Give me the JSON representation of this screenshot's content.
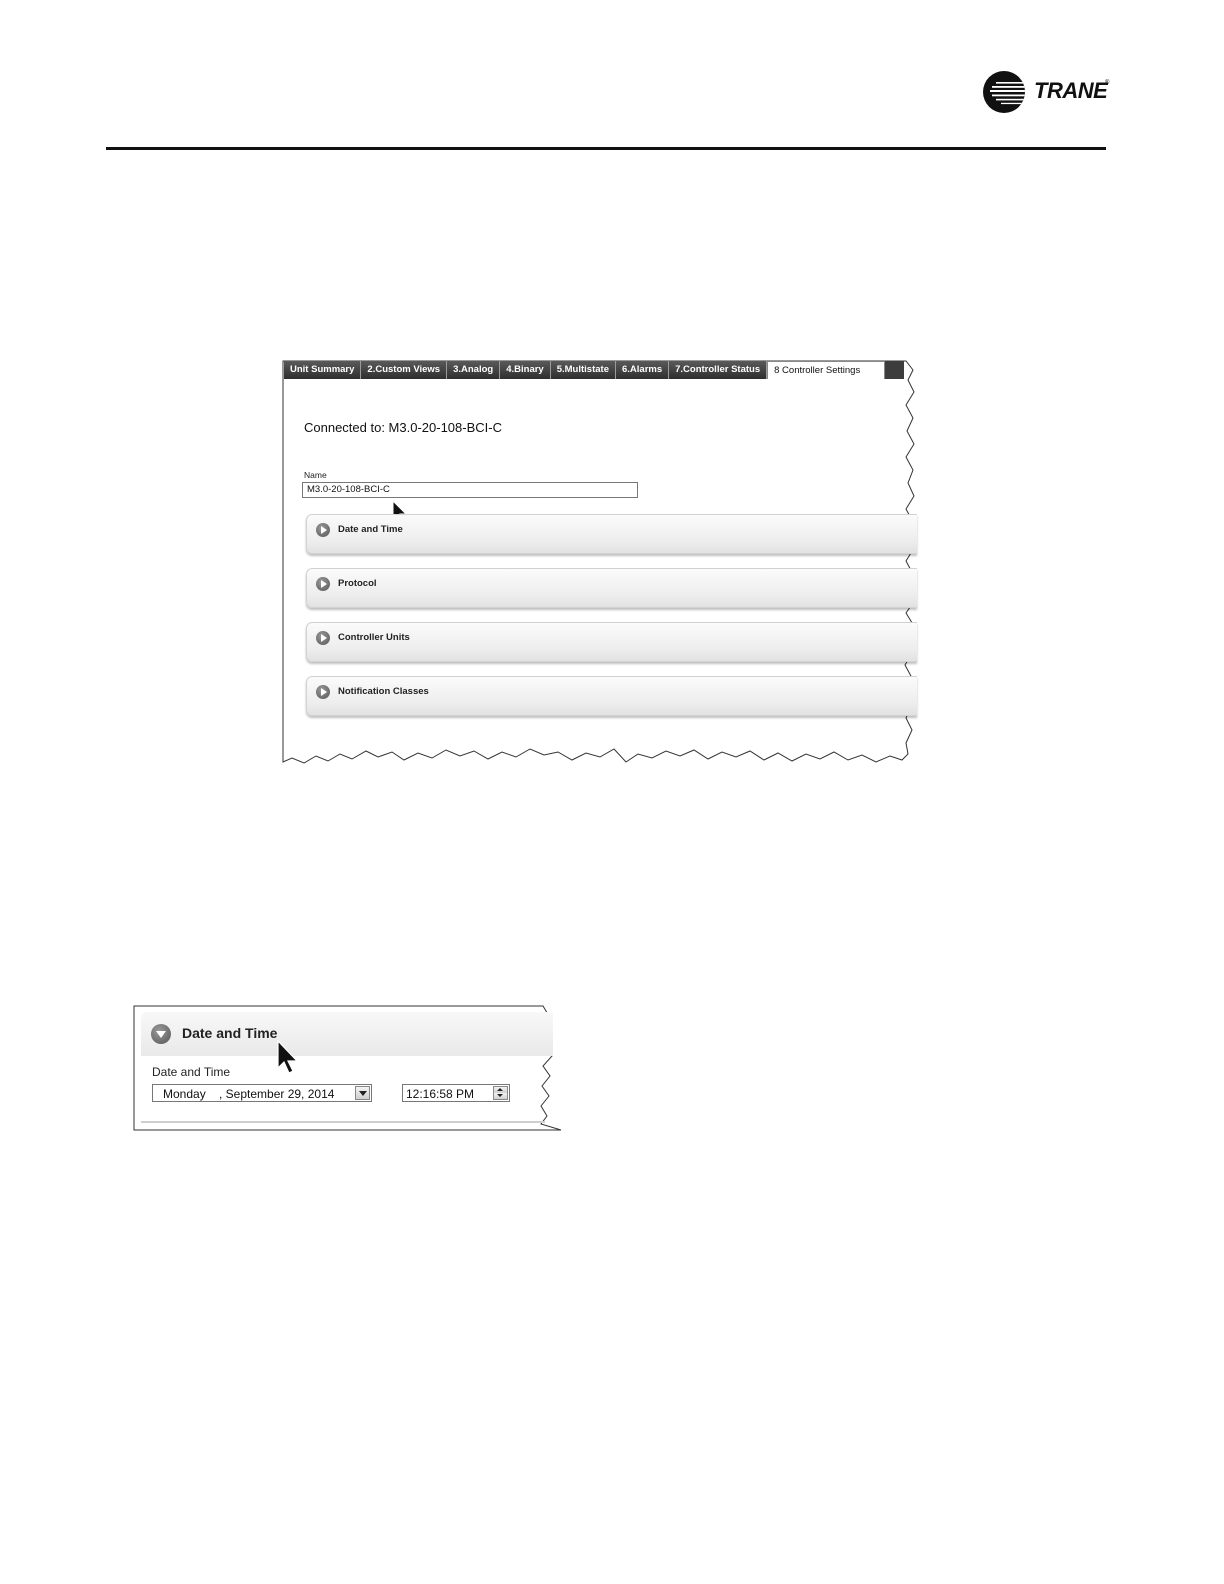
{
  "brand": {
    "name": "TRANE",
    "registered_mark": "®"
  },
  "screenshot1": {
    "tabs": [
      {
        "label": "Unit Summary",
        "active": false
      },
      {
        "label": "2.Custom Views",
        "active": false
      },
      {
        "label": "3.Analog",
        "active": false
      },
      {
        "label": "4.Binary",
        "active": false
      },
      {
        "label": "5.Multistate",
        "active": false
      },
      {
        "label": "6.Alarms",
        "active": false
      },
      {
        "label": "7.Controller Status",
        "active": false
      },
      {
        "label": "8 Controller Settings",
        "active": true
      }
    ],
    "connected_to": "Connected to: M3.0-20-108-BCI-C",
    "name_label": "Name",
    "name_value": "M3.0-20-108-BCI-C",
    "sections": [
      {
        "title": "Date and Time"
      },
      {
        "title": "Protocol"
      },
      {
        "title": "Controller Units"
      },
      {
        "title": "Notification Classes"
      }
    ]
  },
  "screenshot2": {
    "section_title": "Date and Time",
    "field_label": "Date and Time",
    "day": "Monday",
    "date": ", September 29, 2014",
    "time": "12:16:58 PM"
  },
  "icons": {
    "logo": "trane-globe-icon",
    "expander_collapsed": "play-circle-icon",
    "expander_expanded": "chevron-down-circle-icon",
    "cursor": "mouse-pointer-icon",
    "dropdown": "dropdown-arrow-icon",
    "spinner": "spinner-icon"
  }
}
